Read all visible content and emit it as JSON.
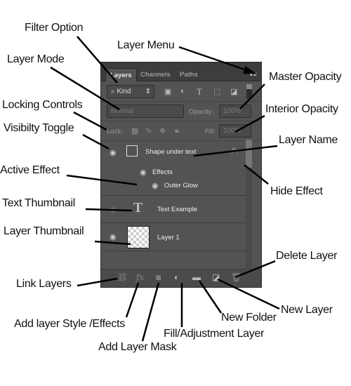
{
  "panel": {
    "tabs": [
      "Layers",
      "Channels",
      "Paths"
    ],
    "menu_icon": "panel-menu-icon",
    "filter": {
      "icon": "search-icon",
      "value": "Kind"
    },
    "blend_mode": "Normal",
    "opacity_label": "Opacity:",
    "opacity_value": "100%",
    "lock_label": "Lock:",
    "fill_label": "Fill:",
    "fill_value": "100%",
    "layers": [
      {
        "name": "Shape under text",
        "fx": "fx",
        "effects_label": "Effects",
        "effect": "Outer Glow"
      },
      {
        "name": "Text Example",
        "thumb": "T"
      },
      {
        "name": "Layer 1"
      }
    ],
    "bottom_icons": [
      "link-icon",
      "fx-icon",
      "mask-icon",
      "adjustment-icon",
      "folder-icon",
      "new-layer-icon",
      "trash-icon"
    ],
    "fx_symbol": "fx"
  },
  "annotations": {
    "filter_option": "Filter Option",
    "layer_menu": "Layer Menu",
    "layer_mode": "Layer Mode",
    "master_opacity": "Master Opacity",
    "locking_controls": "Locking Controls",
    "interior_opacity": "Interior Opacity",
    "visibility_toggle": "Visibilty Toggle",
    "layer_name": "Layer Name",
    "active_effect": "Active Effect",
    "hide_effect": "Hide Effect",
    "text_thumbnail": "Text Thumbnail",
    "layer_thumbnail": "Layer Thumbnail",
    "delete_layer": "Delete Layer",
    "link_layers": "Link Layers",
    "new_layer": "New Layer",
    "new_folder": "New Folder",
    "add_style": "Add layer Style /Effects",
    "fill_adjustment": "Fill/Adjustment Layer",
    "add_mask": "Add Layer Mask"
  }
}
